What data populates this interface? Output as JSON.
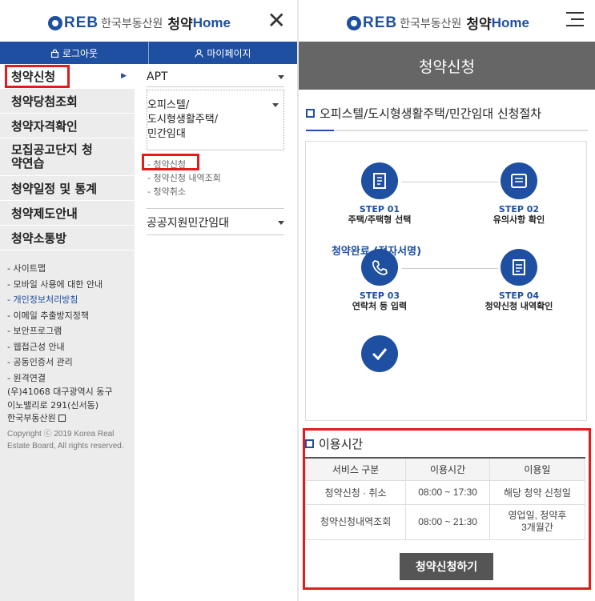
{
  "logo": {
    "reb": "REB",
    "org": "한국부동산원",
    "brand": "청약",
    "home": "Home"
  },
  "left": {
    "topbar": {
      "logout": "로그아웃",
      "mypage": "마이페이지"
    },
    "menu": [
      "청약신청",
      "청약당첨조회",
      "청약자격확인",
      "모집공고단지 청약연습",
      "청약일정 및 통계",
      "청약제도안내",
      "청약소통방"
    ],
    "links": [
      "- 사이트맵",
      "- 모바일 사용에 대한 안내",
      "- 개인정보처리방침",
      "- 이메일 추출방지정책",
      "- 보안프로그램",
      "- 웹접근성 안내",
      "- 공동인증서 관리",
      "- 원격연결"
    ],
    "address": [
      "(우)41068 대구광역시 동구",
      "이노밸리로 291(신서동)",
      "한국부동산원"
    ],
    "copyright": "Copyright ⓒ 2019 Korea Real Estate Board, All rights reserved.",
    "submenu": {
      "apt": "APT",
      "officetel": "오피스텔/\n도시형생활주택/\n민간임대",
      "sublinks": [
        "- 청약신청",
        "- 청약신청 내역조회",
        "- 청약취소"
      ],
      "public": "공공지원민간임대"
    }
  },
  "right": {
    "hero": "청약신청",
    "section_title": "오피스텔/도시형생활주택/민간임대 신청절차",
    "steps": [
      {
        "no": "STEP 01",
        "desc": "주택/주택형 선택",
        "icon": "document-icon"
      },
      {
        "no": "STEP 02",
        "desc": "유의사항 확인",
        "icon": "notice-icon"
      },
      {
        "no": "STEP 03",
        "desc": "연락처 등 입력",
        "icon": "phone-icon"
      },
      {
        "no": "STEP 04",
        "desc": "청약신청 내역확인",
        "icon": "checklist-icon"
      }
    ],
    "done": "청약완료 (전자서명)",
    "usage_title": "이용시간",
    "table": {
      "headers": [
        "서비스 구분",
        "이용시간",
        "이용일"
      ],
      "rows": [
        [
          "청약신청 · 취소",
          "08:00 ~ 17:30",
          "해당 청약 신청일"
        ],
        [
          "청약신청내역조회",
          "08:00 ~ 21:30",
          "영업일, 청약후\n3개월간"
        ]
      ]
    },
    "apply_button": "청약신청하기"
  },
  "colors": {
    "brand_blue": "#1e4fa0",
    "highlight_red": "#e21b1b",
    "hero_gray": "#666666"
  }
}
